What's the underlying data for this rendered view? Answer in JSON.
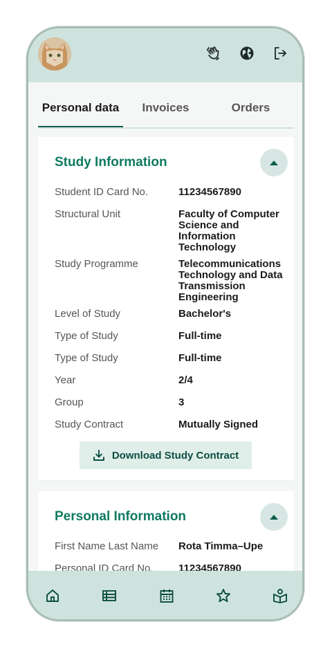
{
  "header": {
    "avatar_alt": "Profile photo",
    "icons": [
      "hand-wave-icon",
      "globe-icon",
      "logout-icon"
    ]
  },
  "tabs": [
    {
      "label": "Personal data",
      "active": true
    },
    {
      "label": "Invoices",
      "active": false
    },
    {
      "label": "Orders",
      "active": false
    }
  ],
  "study": {
    "title": "Study Information",
    "rows": [
      {
        "label": "Student ID Card No.",
        "value": "11234567890"
      },
      {
        "label": "Structural Unit",
        "value": "Faculty of Computer Science and Information Technology"
      },
      {
        "label": "Study Programme",
        "value": "Telecommunications Technology and Data Transmission Engineering"
      },
      {
        "label": "Level of Study",
        "value": "Bachelor's"
      },
      {
        "label": "Type of Study",
        "value": "Full-time"
      },
      {
        "label": "Type of Study",
        "value": "Full-time"
      },
      {
        "label": "Year",
        "value": "2/4"
      },
      {
        "label": "Group",
        "value": "3"
      },
      {
        "label": "Study Contract",
        "value": "Mutually Signed"
      }
    ],
    "download_label": "Download Study Contract"
  },
  "personal": {
    "title": "Personal Information",
    "rows": [
      {
        "label": "First Name Last Name",
        "value": "Rota Timma–Upe"
      },
      {
        "label": "Personal ID Card No.",
        "value": "11234567890"
      }
    ]
  },
  "bottom_nav": [
    "home-icon",
    "list-icon",
    "calendar-icon",
    "star-icon",
    "book-user-icon"
  ],
  "colors": {
    "accent": "#0e7a61",
    "bar": "#cfe3de",
    "button": "#e0eeea"
  }
}
